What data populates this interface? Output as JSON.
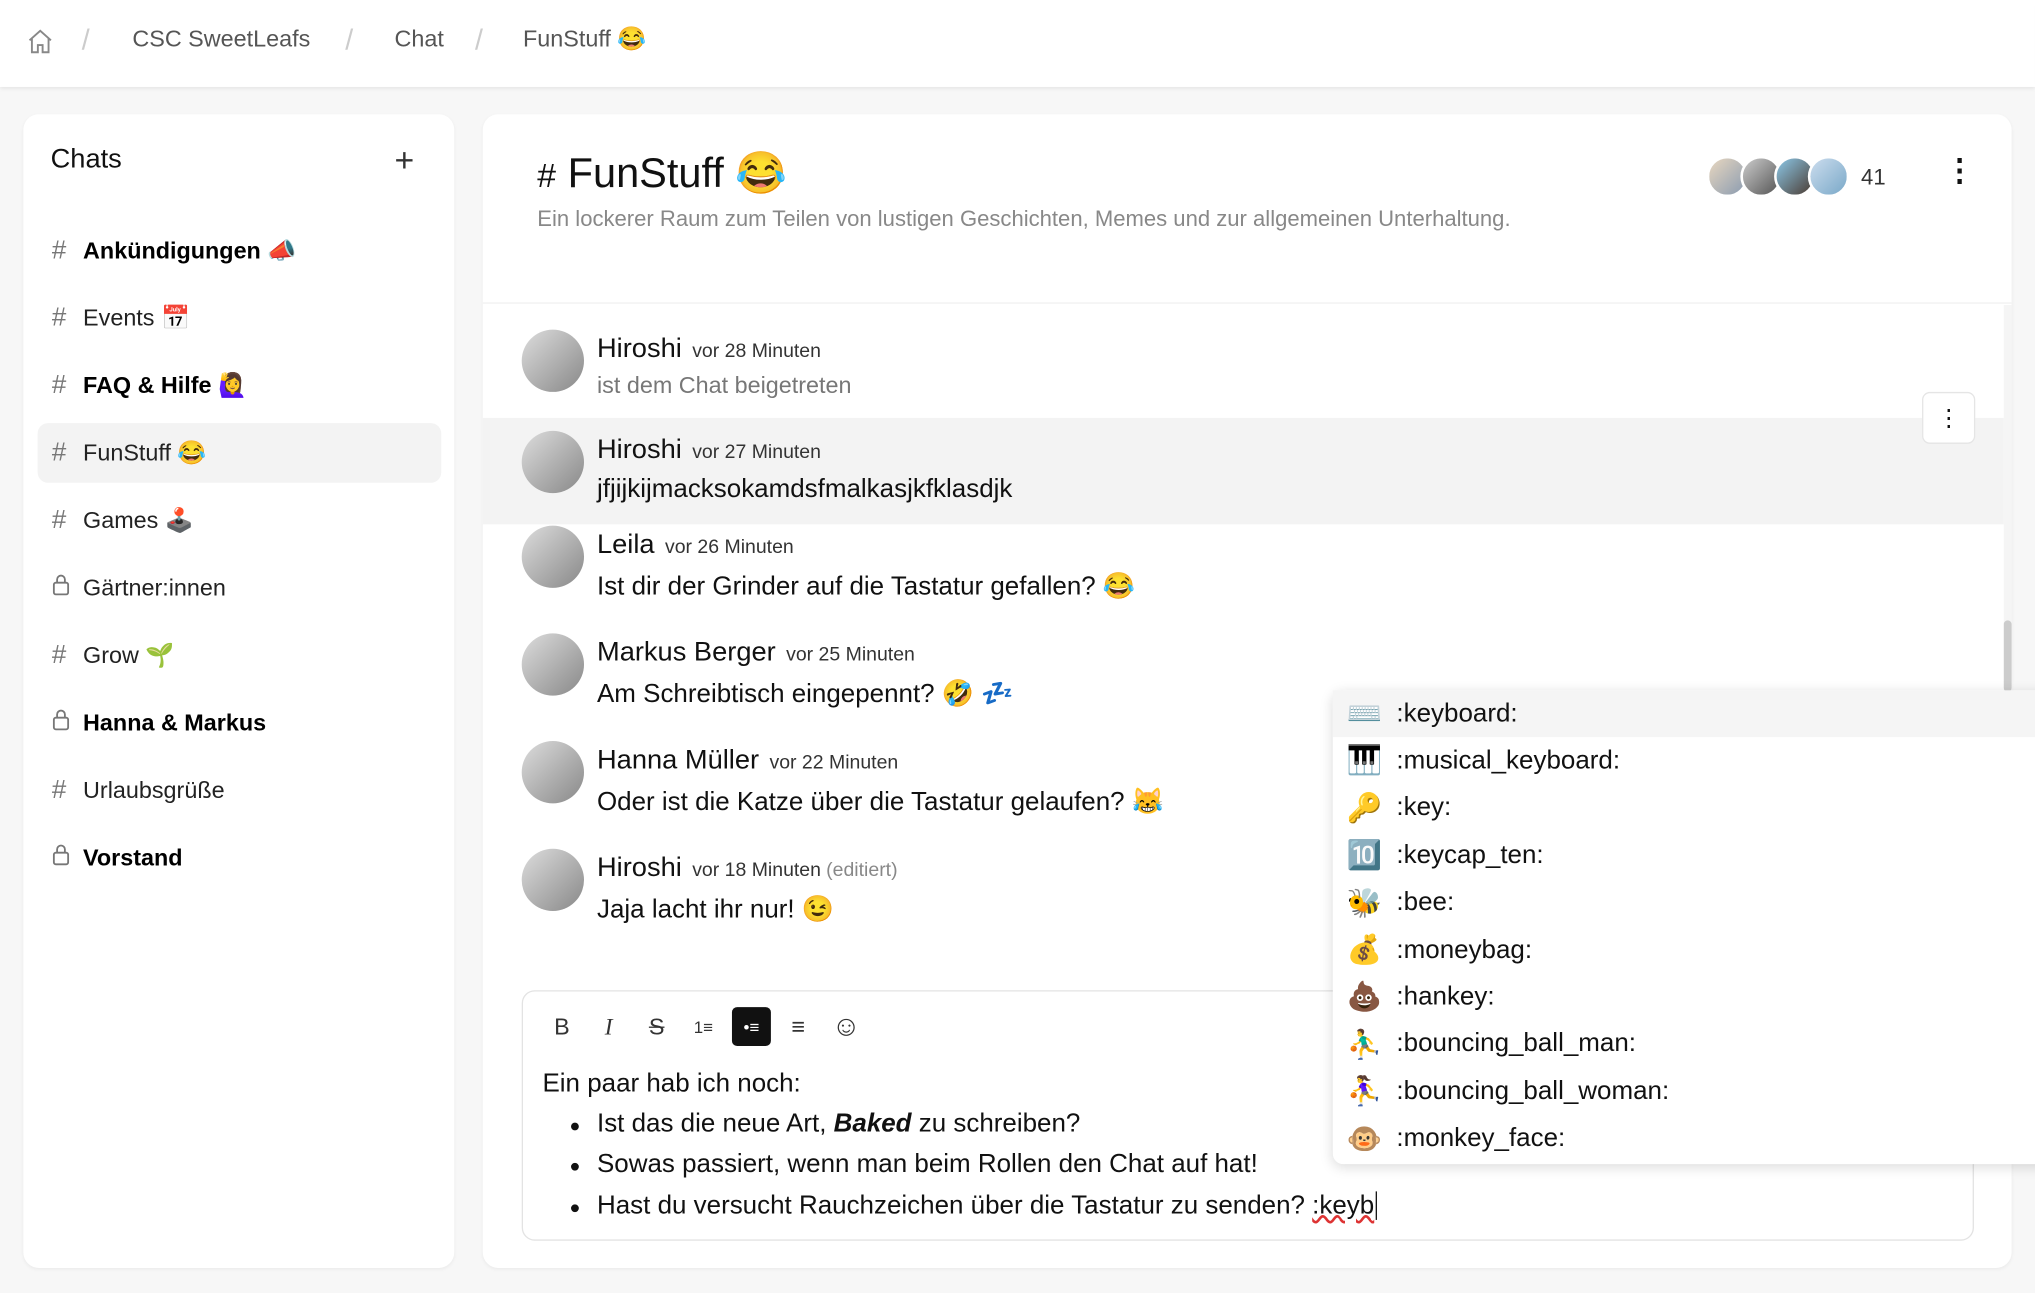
{
  "breadcrumb": {
    "items": [
      "CSC SweetLeafs",
      "Chat",
      "FunStuff 😂"
    ]
  },
  "sidebar": {
    "title": "Chats",
    "items": [
      {
        "icon": "#",
        "label": "Ankündigungen 📣",
        "bold": true
      },
      {
        "icon": "#",
        "label": "Events 📅",
        "bold": false
      },
      {
        "icon": "#",
        "label": "FAQ & Hilfe 🙋‍♀️",
        "bold": true
      },
      {
        "icon": "#",
        "label": "FunStuff 😂",
        "bold": false,
        "active": true
      },
      {
        "icon": "#",
        "label": "Games 🕹️",
        "bold": false
      },
      {
        "icon": "lock",
        "label": "Gärtner:innen",
        "bold": false
      },
      {
        "icon": "#",
        "label": "Grow 🌱",
        "bold": false
      },
      {
        "icon": "lock",
        "label": "Hanna & Markus",
        "bold": true
      },
      {
        "icon": "#",
        "label": "Urlaubsgrüße",
        "bold": false
      },
      {
        "icon": "lock",
        "label": "Vorstand",
        "bold": true
      }
    ]
  },
  "channel": {
    "hash": "#",
    "title": "FunStuff 😂",
    "description": "Ein lockerer Raum zum Teilen von lustigen Geschichten, Memes und zur allgemeinen Unterhaltung.",
    "member_count": "41"
  },
  "messages": [
    {
      "author": "Hiroshi",
      "time": "vor 28 Minuten",
      "text": "ist dem Chat beigetreten",
      "system": true
    },
    {
      "author": "Hiroshi",
      "time": "vor 27 Minuten",
      "text": "jfjijkijmacksokamdsfmalkasjkfklasdjk"
    },
    {
      "author": "Leila",
      "time": "vor 26 Minuten",
      "text": "Ist dir der Grinder auf die Tastatur gefallen? 😂"
    },
    {
      "author": "Markus Berger",
      "time": "vor 25 Minuten",
      "text": "Am Schreibtisch eingepennt? 🤣 💤"
    },
    {
      "author": "Hanna Müller",
      "time": "vor 22 Minuten",
      "text": "Oder ist die Katze über die Tastatur gelaufen? 😹"
    },
    {
      "author": "Hiroshi",
      "time": "vor 18 Minuten",
      "edited": "(editiert)",
      "text": "Jaja lacht ihr nur! 😉"
    }
  ],
  "composer": {
    "toolbar": [
      "B",
      "I",
      "S",
      "1≡",
      "•≡",
      "≡",
      "☺"
    ],
    "intro": "Ein paar hab ich noch:",
    "bullet1_pre": "Ist das die neue Art, ",
    "bullet1_bold": "Baked",
    "bullet1_post": " zu schreiben?",
    "bullet2": "Sowas passiert, wenn man beim Rollen den Chat auf hat!",
    "bullet3_pre": "Hast du versucht Rauchzeichen über die Tastatur zu senden? ",
    "bullet3_typed": ":keyb"
  },
  "emoji_suggestions": [
    {
      "emoji": "⌨️",
      "code": ":keyboard:"
    },
    {
      "emoji": "🎹",
      "code": ":musical_keyboard:"
    },
    {
      "emoji": "🔑",
      "code": ":key:"
    },
    {
      "emoji": "🔟",
      "code": ":keycap_ten:"
    },
    {
      "emoji": "🐝",
      "code": ":bee:"
    },
    {
      "emoji": "💰",
      "code": ":moneybag:"
    },
    {
      "emoji": "💩",
      "code": ":hankey:"
    },
    {
      "emoji": "⛹️‍♂️",
      "code": ":bouncing_ball_man:"
    },
    {
      "emoji": "⛹️‍♀️",
      "code": ":bouncing_ball_woman:"
    },
    {
      "emoji": "🐵",
      "code": ":monkey_face:"
    }
  ]
}
